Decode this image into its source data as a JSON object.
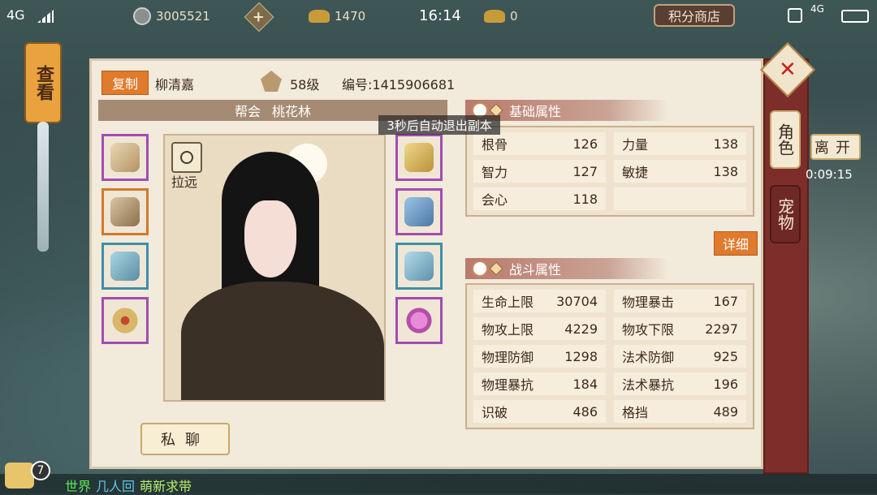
{
  "status": {
    "signal": "4G",
    "coins": "3005521",
    "ingots": "1470",
    "time": "16:14",
    "gold": "0",
    "shop_label": "积分商店",
    "net": "4G"
  },
  "side_lantern": "查看",
  "player": {
    "copy_label": "复制",
    "name": "柳清嘉",
    "level": "58级",
    "id": "编号:1415906681",
    "guild_label": "帮会",
    "guild_name": "桃花林",
    "zoom_label": "拉远",
    "chat_label": "私聊"
  },
  "toast": "3秒后自动退出副本",
  "basic": {
    "title": "基础属性",
    "rows": [
      [
        {
          "k": "根骨",
          "v": "126"
        },
        {
          "k": "力量",
          "v": "138"
        }
      ],
      [
        {
          "k": "智力",
          "v": "127"
        },
        {
          "k": "敏捷",
          "v": "138"
        }
      ],
      [
        {
          "k": "会心",
          "v": "118"
        },
        {
          "k": "",
          "v": ""
        }
      ]
    ],
    "detail_label": "详细"
  },
  "battle": {
    "title": "战斗属性",
    "rows": [
      [
        {
          "k": "生命上限",
          "v": "30704"
        },
        {
          "k": "物理暴击",
          "v": "167"
        }
      ],
      [
        {
          "k": "物攻上限",
          "v": "4229"
        },
        {
          "k": "物攻下限",
          "v": "2297"
        }
      ],
      [
        {
          "k": "物理防御",
          "v": "1298"
        },
        {
          "k": "法术防御",
          "v": "925"
        }
      ],
      [
        {
          "k": "物理暴抗",
          "v": "184"
        },
        {
          "k": "法术暴抗",
          "v": "196"
        }
      ],
      [
        {
          "k": "识破",
          "v": "486"
        },
        {
          "k": "格挡",
          "v": "489"
        }
      ]
    ]
  },
  "tabs": {
    "role": "角色",
    "pet": "宠物"
  },
  "leave_label": "离开",
  "timer": "0:09:15",
  "chat": {
    "badge": "7",
    "channel": "世界",
    "player": "几人回",
    "message": "萌新求带"
  },
  "equipment_left": [
    {
      "name": "sword-slot",
      "color": "#a24db0"
    },
    {
      "name": "armor-slot",
      "color": "#d27a2b"
    },
    {
      "name": "belt-slot",
      "color": "#3f8ea8"
    },
    {
      "name": "ring-slot",
      "color": "#a24db0"
    }
  ],
  "equipment_right": [
    {
      "name": "cape-slot",
      "color": "#a24db0"
    },
    {
      "name": "pants-slot",
      "color": "#a24db0"
    },
    {
      "name": "boots-slot",
      "color": "#3f8ea8"
    },
    {
      "name": "pendant-slot",
      "color": "#a24db0"
    }
  ]
}
